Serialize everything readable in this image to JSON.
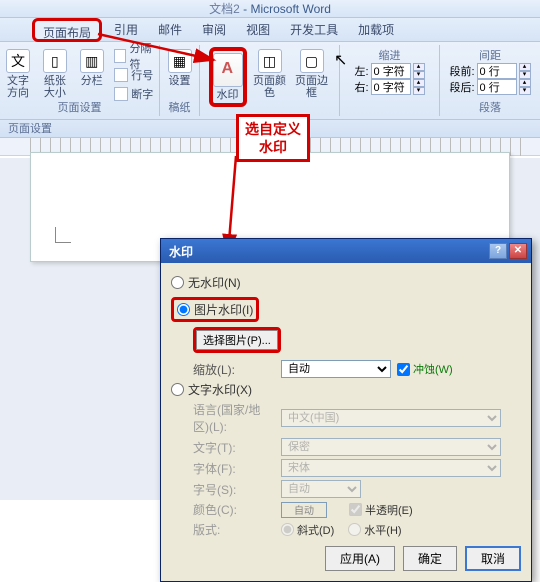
{
  "app": {
    "doc_name": "文档2",
    "app_name": "Microsoft Word"
  },
  "tabs": {
    "page_layout": "页面布局",
    "references": "引用",
    "mailings": "邮件",
    "review": "审阅",
    "view": "视图",
    "developer": "开发工具",
    "addins": "加载项"
  },
  "ribbon": {
    "text_direction": "文字方向",
    "paper_size": "纸张大小",
    "columns": "分栏",
    "breaks": "分隔符",
    "line_numbers": "行号",
    "hyphenation": "断字",
    "page_setup_group": "页面设置",
    "theme_setup": "设置",
    "watermark": "水印",
    "page_color": "页面颜色",
    "page_border": "页面边框",
    "draft_group": "稿纸",
    "indent_label": "缩进",
    "indent_left_lbl": "左:",
    "indent_left_val": "0 字符",
    "indent_right_lbl": "右:",
    "indent_right_val": "0 字符",
    "spacing_label": "间距",
    "spacing_before_lbl": "段前:",
    "spacing_before_val": "0 行",
    "spacing_after_lbl": "段后:",
    "spacing_after_val": "0 行",
    "paragraph_group": "段落"
  },
  "section_label": "页面设置",
  "annotation": "选自定义水印",
  "dialog": {
    "title": "水印",
    "opt_none": "无水印(N)",
    "opt_picture": "图片水印(I)",
    "select_picture_btn": "选择图片(P)...",
    "scale_lbl": "缩放(L):",
    "scale_val": "自动",
    "washout_lbl": "冲蚀(W)",
    "opt_text": "文字水印(X)",
    "lang_lbl": "语言(国家/地区)(L):",
    "lang_val": "中文(中国)",
    "text_lbl": "文字(T):",
    "text_val": "保密",
    "font_lbl": "字体(F):",
    "font_val": "宋体",
    "size_lbl": "字号(S):",
    "size_val": "自动",
    "color_lbl": "颜色(C):",
    "color_val": "自动",
    "semitrans_lbl": "半透明(E)",
    "layout_lbl": "版式:",
    "layout_diag": "斜式(D)",
    "layout_horiz": "水平(H)",
    "btn_apply": "应用(A)",
    "btn_ok": "确定",
    "btn_cancel": "取消"
  }
}
